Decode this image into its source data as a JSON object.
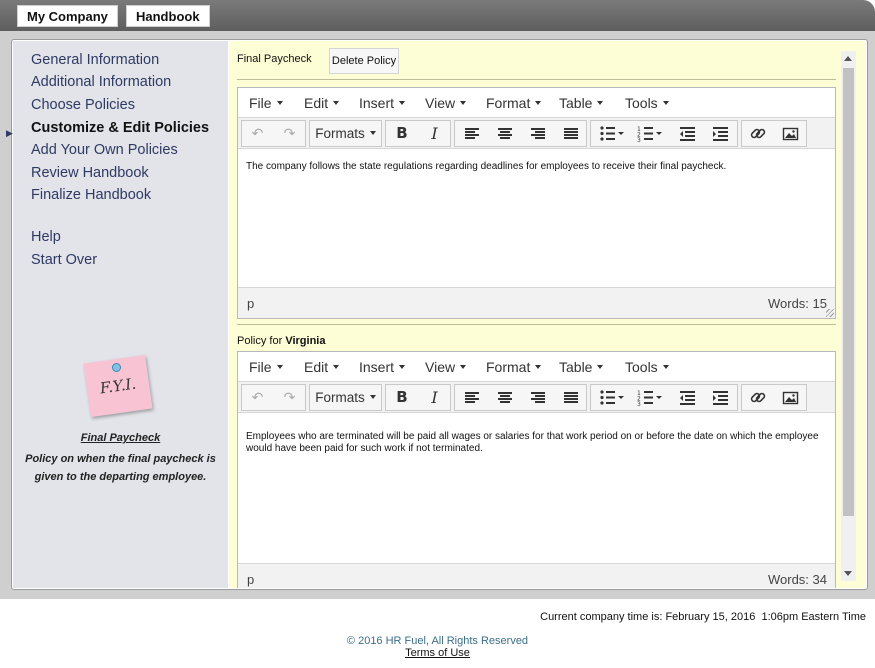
{
  "top_tabs": {
    "company": "My Company",
    "handbook": "Handbook"
  },
  "sidebar": {
    "items": [
      {
        "label": "General Information",
        "active": false
      },
      {
        "label": "Additional Information",
        "active": false
      },
      {
        "label": "Choose Policies",
        "active": false
      },
      {
        "label": "Customize & Edit Policies",
        "active": true
      },
      {
        "label": "Add Your Own Policies",
        "active": false
      },
      {
        "label": "Review Handbook",
        "active": false
      },
      {
        "label": "Finalize Handbook",
        "active": false
      },
      {
        "label": "Help",
        "active": false
      },
      {
        "label": "Start Over",
        "active": false
      }
    ],
    "fyi": {
      "note_text": "F.Y.I.",
      "title": "Final Paycheck",
      "description": "Policy on when the final paycheck is given to the departing employee."
    }
  },
  "policy": {
    "title": "Final Paycheck",
    "delete_label": "Delete Policy",
    "state_prefix": "Policy for",
    "state": "Virginia"
  },
  "editor_menu": [
    "File",
    "Edit",
    "Insert",
    "View",
    "Format",
    "Table",
    "Tools"
  ],
  "editor_toolbar": {
    "formats_label": "Formats",
    "bold": "B",
    "italic": "I"
  },
  "editor1": {
    "body": "The company follows the state regulations regarding deadlines for employees to receive their final paycheck.",
    "path": "p",
    "words": "Words: 15"
  },
  "editor2": {
    "body": "Employees who are terminated will be paid all wages or salaries for that work period on or before the date on which the employee would have been paid for such work if not terminated.",
    "path": "p",
    "words": "Words: 34"
  },
  "footer": {
    "time_text": "Current company time is: February 15, 2016  1:06pm Eastern Time",
    "copyright": "© 2016 HR Fuel, All Rights Reserved",
    "terms": "Terms of Use"
  },
  "colors": {
    "content_bg": "#fdfdd6",
    "sidebar_bg": "#e2e4ea",
    "nav_link": "#2f3a63",
    "topbar": "#6b6b6b",
    "copyright": "#3a6e8a"
  },
  "icons": [
    "undo-icon",
    "redo-icon",
    "align-left-icon",
    "align-center-icon",
    "align-right-icon",
    "align-justify-icon",
    "bullet-list-icon",
    "numbered-list-icon",
    "outdent-icon",
    "indent-icon",
    "link-icon",
    "image-icon",
    "resize-grip-icon"
  ]
}
